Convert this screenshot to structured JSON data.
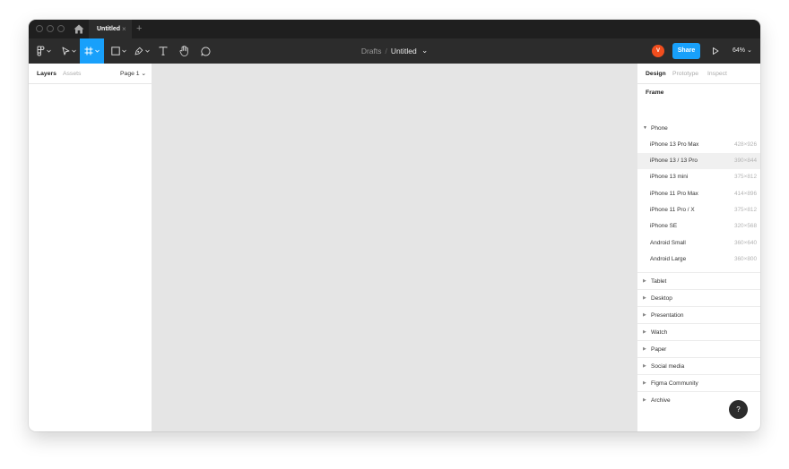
{
  "titlebar": {
    "tab_label": "Untitled",
    "tab_close": "×",
    "tab_add": "+"
  },
  "toolbar": {
    "crumb_drafts": "Drafts",
    "crumb_separator": "/",
    "crumb_file": "Untitled",
    "crumb_caret": "⌄",
    "avatar_letter": "V",
    "share_label": "Share",
    "zoom_label": "64% ⌄",
    "tools": [
      "main-menu-icon",
      "move-icon",
      "frame-icon",
      "shape-icon",
      "pen-icon",
      "text-icon",
      "hand-icon",
      "comment-icon"
    ]
  },
  "left_panel": {
    "tabs": [
      "Layers",
      "Assets"
    ],
    "page_label": "Page 1 ⌄"
  },
  "right_panel": {
    "tabs": [
      "Design",
      "Prototype",
      "Inspect"
    ],
    "frame_heading": "Frame",
    "phone_group": "Phone",
    "devices": [
      {
        "name": "iPhone 13 Pro Max",
        "size": "428×926"
      },
      {
        "name": "iPhone 13 / 13 Pro",
        "size": "390×844"
      },
      {
        "name": "iPhone 13 mini",
        "size": "375×812"
      },
      {
        "name": "iPhone 11 Pro Max",
        "size": "414×896"
      },
      {
        "name": "iPhone 11 Pro / X",
        "size": "375×812"
      },
      {
        "name": "iPhone SE",
        "size": "320×568"
      },
      {
        "name": "Android Small",
        "size": "360×640"
      },
      {
        "name": "Android Large",
        "size": "360×800"
      }
    ],
    "categories": [
      "Tablet",
      "Desktop",
      "Presentation",
      "Watch",
      "Paper",
      "Social media",
      "Figma Community",
      "Archive"
    ]
  },
  "help": {
    "label": "?"
  },
  "colors": {
    "accent": "#18a0fb",
    "avatar": "#f24e1e",
    "toolbar": "#2c2c2c",
    "titlebar": "#1f1f1f",
    "canvas": "#e5e5e5"
  }
}
